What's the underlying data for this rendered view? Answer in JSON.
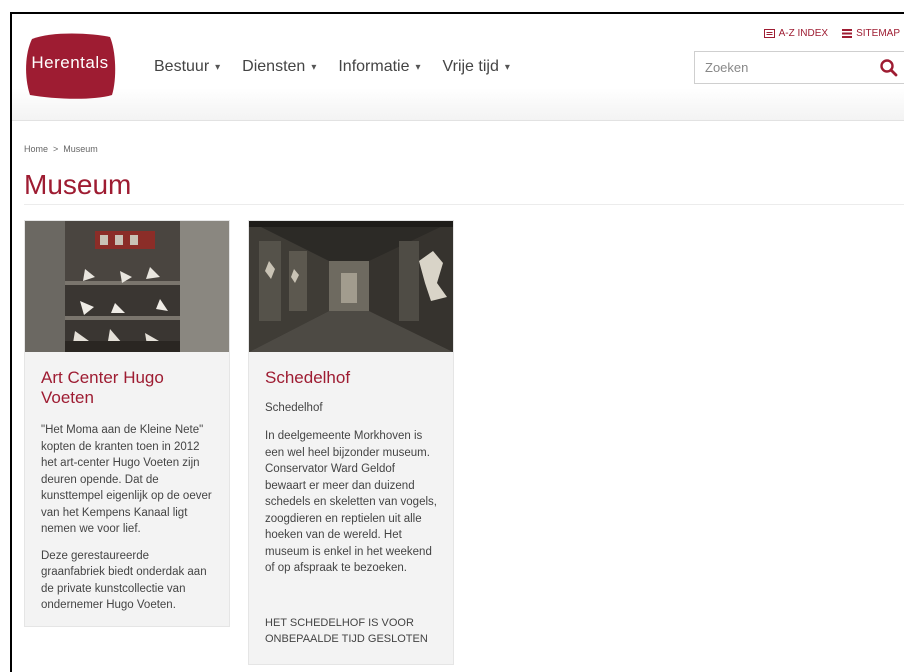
{
  "header": {
    "logo_text": "Herentals",
    "brand_color": "#9e1c32",
    "nav": [
      {
        "label": "Bestuur",
        "icon": "chevron-down-icon"
      },
      {
        "label": "Diensten",
        "icon": "chevron-down-icon"
      },
      {
        "label": "Informatie",
        "icon": "chevron-down-icon"
      },
      {
        "label": "Vrije tijd",
        "icon": "chevron-down-icon"
      }
    ],
    "utility": {
      "az_label": "A-Z INDEX",
      "sitemap_label": "SITEMAP"
    },
    "search": {
      "placeholder": "Zoeken",
      "icon": "search-icon"
    }
  },
  "breadcrumb": {
    "home": "Home",
    "separator": ">",
    "current": "Museum"
  },
  "page": {
    "title": "Museum"
  },
  "cards": [
    {
      "title": "Art Center Hugo Voeten",
      "paragraphs": [
        "\"Het Moma aan de Kleine Nete\" kopten de kranten toen in 2012 het art-center Hugo Voeten zijn deuren opende. Dat de kunsttempel eigenlijk op de oever van het Kempens Kanaal ligt nemen we voor lief.",
        "Deze gerestaureerde graanfabriek biedt onderdak aan de private kunstcollectie van ondernemer Hugo Voeten."
      ]
    },
    {
      "title": "Schedelhof",
      "subtitle": "Schedelhof",
      "paragraphs": [
        "In deelgemeente Morkhoven is een wel heel bijzonder museum. Conservator Ward Geldof bewaart er meer dan duizend schedels en skeletten van vogels, zoogdieren en reptielen uit alle hoeken van de wereld. Het museum is enkel in het weekend of op afspraak te bezoeken."
      ],
      "note": "HET SCHEDELHOF IS VOOR ONBEPAALDE TIJD GESLOTEN"
    }
  ]
}
